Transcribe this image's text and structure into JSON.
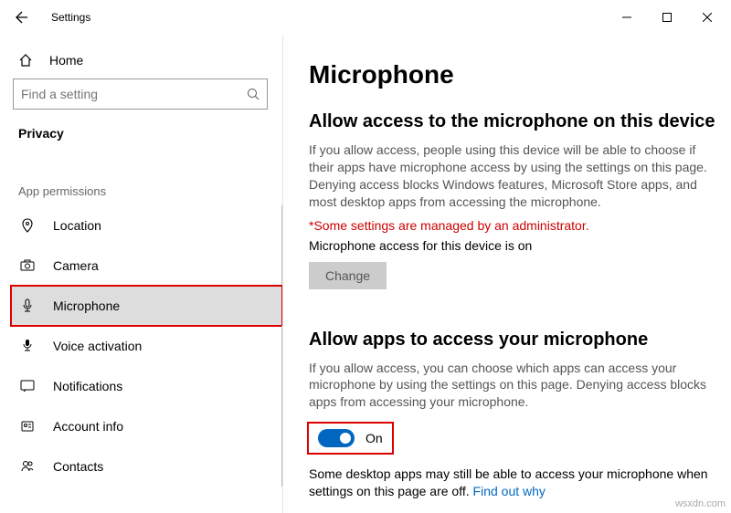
{
  "titlebar": {
    "app": "Settings"
  },
  "sidebar": {
    "home": "Home",
    "search_placeholder": "Find a setting",
    "section": "Privacy",
    "group": "App permissions",
    "items": [
      {
        "label": "Location"
      },
      {
        "label": "Camera"
      },
      {
        "label": "Microphone"
      },
      {
        "label": "Voice activation"
      },
      {
        "label": "Notifications"
      },
      {
        "label": "Account info"
      },
      {
        "label": "Contacts"
      }
    ]
  },
  "main": {
    "h1": "Microphone",
    "s1": {
      "h2": "Allow access to the microphone on this device",
      "body": "If you allow access, people using this device will be able to choose if their apps have microphone access by using the settings on this page. Denying access blocks Windows features, Microsoft Store apps, and most desktop apps from accessing the microphone.",
      "admin": "*Some settings are managed by an administrator.",
      "status": "Microphone access for this device is on",
      "change": "Change"
    },
    "s2": {
      "h2": "Allow apps to access your microphone",
      "body": "If you allow access, you can choose which apps can access your microphone by using the settings on this page. Denying access blocks apps from accessing your microphone.",
      "toggle_label": "On",
      "note1": "Some desktop apps may still be able to access your microphone when settings on this page are off. ",
      "link": "Find out why"
    }
  },
  "watermark": "wsxdn.com"
}
